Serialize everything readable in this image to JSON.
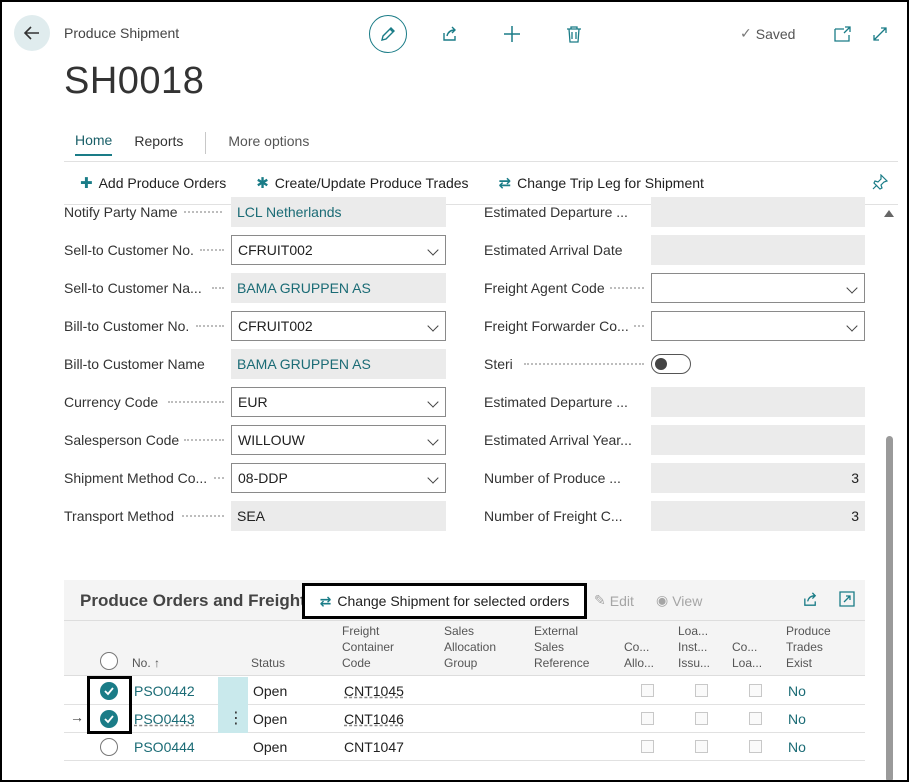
{
  "header": {
    "caption": "Produce Shipment",
    "title": "SH0018",
    "saved_label": "Saved"
  },
  "tabs": [
    {
      "label": "Home"
    },
    {
      "label": "Reports"
    },
    {
      "label": "More options"
    }
  ],
  "actions": [
    {
      "label": "Add Produce Orders",
      "icon": "plus-icon"
    },
    {
      "label": "Create/Update Produce Trades",
      "icon": "asterisk-icon"
    },
    {
      "label": "Change Trip Leg for Shipment",
      "icon": "swap-arrows-icon"
    }
  ],
  "left_fields": [
    {
      "label": "Notify Party Name",
      "value": "LCL Netherlands",
      "kind": "link"
    },
    {
      "label": "Sell-to Customer No.",
      "value": "CFRUIT002",
      "kind": "select"
    },
    {
      "label": "Sell-to Customer Na...",
      "value": "BAMA GRUPPEN AS",
      "kind": "link"
    },
    {
      "label": "Bill-to Customer No.",
      "value": "CFRUIT002",
      "kind": "select"
    },
    {
      "label": "Bill-to Customer Name",
      "value": "BAMA GRUPPEN AS",
      "kind": "link"
    },
    {
      "label": "Currency Code",
      "value": "EUR",
      "kind": "select"
    },
    {
      "label": "Salesperson Code",
      "value": "WILLOUW",
      "kind": "select"
    },
    {
      "label": "Shipment Method Co...",
      "value": "08-DDP",
      "kind": "select"
    },
    {
      "label": "Transport Method",
      "value": "SEA",
      "kind": "readonly"
    }
  ],
  "right_fields": [
    {
      "label": "Estimated Departure ...",
      "value": "",
      "kind": "readonly"
    },
    {
      "label": "Estimated Arrival Date",
      "value": "",
      "kind": "readonly"
    },
    {
      "label": "Freight Agent Code",
      "value": "",
      "kind": "select"
    },
    {
      "label": "Freight Forwarder Co...",
      "value": "",
      "kind": "select"
    },
    {
      "label": "Steri",
      "value": "off",
      "kind": "toggle"
    },
    {
      "label": "Estimated Departure ...",
      "value": "",
      "kind": "readonly"
    },
    {
      "label": "Estimated Arrival Year...",
      "value": "",
      "kind": "readonly"
    },
    {
      "label": "Number of Produce ...",
      "value": "3",
      "kind": "number"
    },
    {
      "label": "Number of Freight C...",
      "value": "3",
      "kind": "number"
    }
  ],
  "subpage": {
    "title": "Produce Orders and Freight",
    "change_shipment_label": "Change Shipment for selected orders",
    "edit_label": "Edit",
    "view_label": "View",
    "columns": {
      "no": "No. ↑",
      "status": "Status",
      "freight": [
        "Freight",
        "Container",
        "Code"
      ],
      "sales_alloc": [
        "Sales",
        "Allocation",
        "Group"
      ],
      "ext_sales": [
        "External",
        "Sales",
        "Reference"
      ],
      "co_allo": [
        "Co...",
        "Allo..."
      ],
      "loa_inst": [
        "Loa...",
        "Inst...",
        "Issu..."
      ],
      "co_loa": [
        "Co...",
        "Loa..."
      ],
      "produce_trades": [
        "Produce",
        "Trades",
        "Exist"
      ]
    },
    "rows": [
      {
        "selected": true,
        "current": false,
        "no": "PSO0442",
        "status": "Open",
        "container": "CNT1045",
        "trades_exist": "No"
      },
      {
        "selected": true,
        "current": true,
        "no": "PSO0443",
        "status": "Open",
        "container": "CNT1046",
        "trades_exist": "No"
      },
      {
        "selected": false,
        "current": false,
        "no": "PSO0444",
        "status": "Open",
        "container": "CNT1047",
        "trades_exist": "No"
      }
    ]
  },
  "colors": {
    "accent": "#1a7c87",
    "link": "#1a6b75"
  }
}
